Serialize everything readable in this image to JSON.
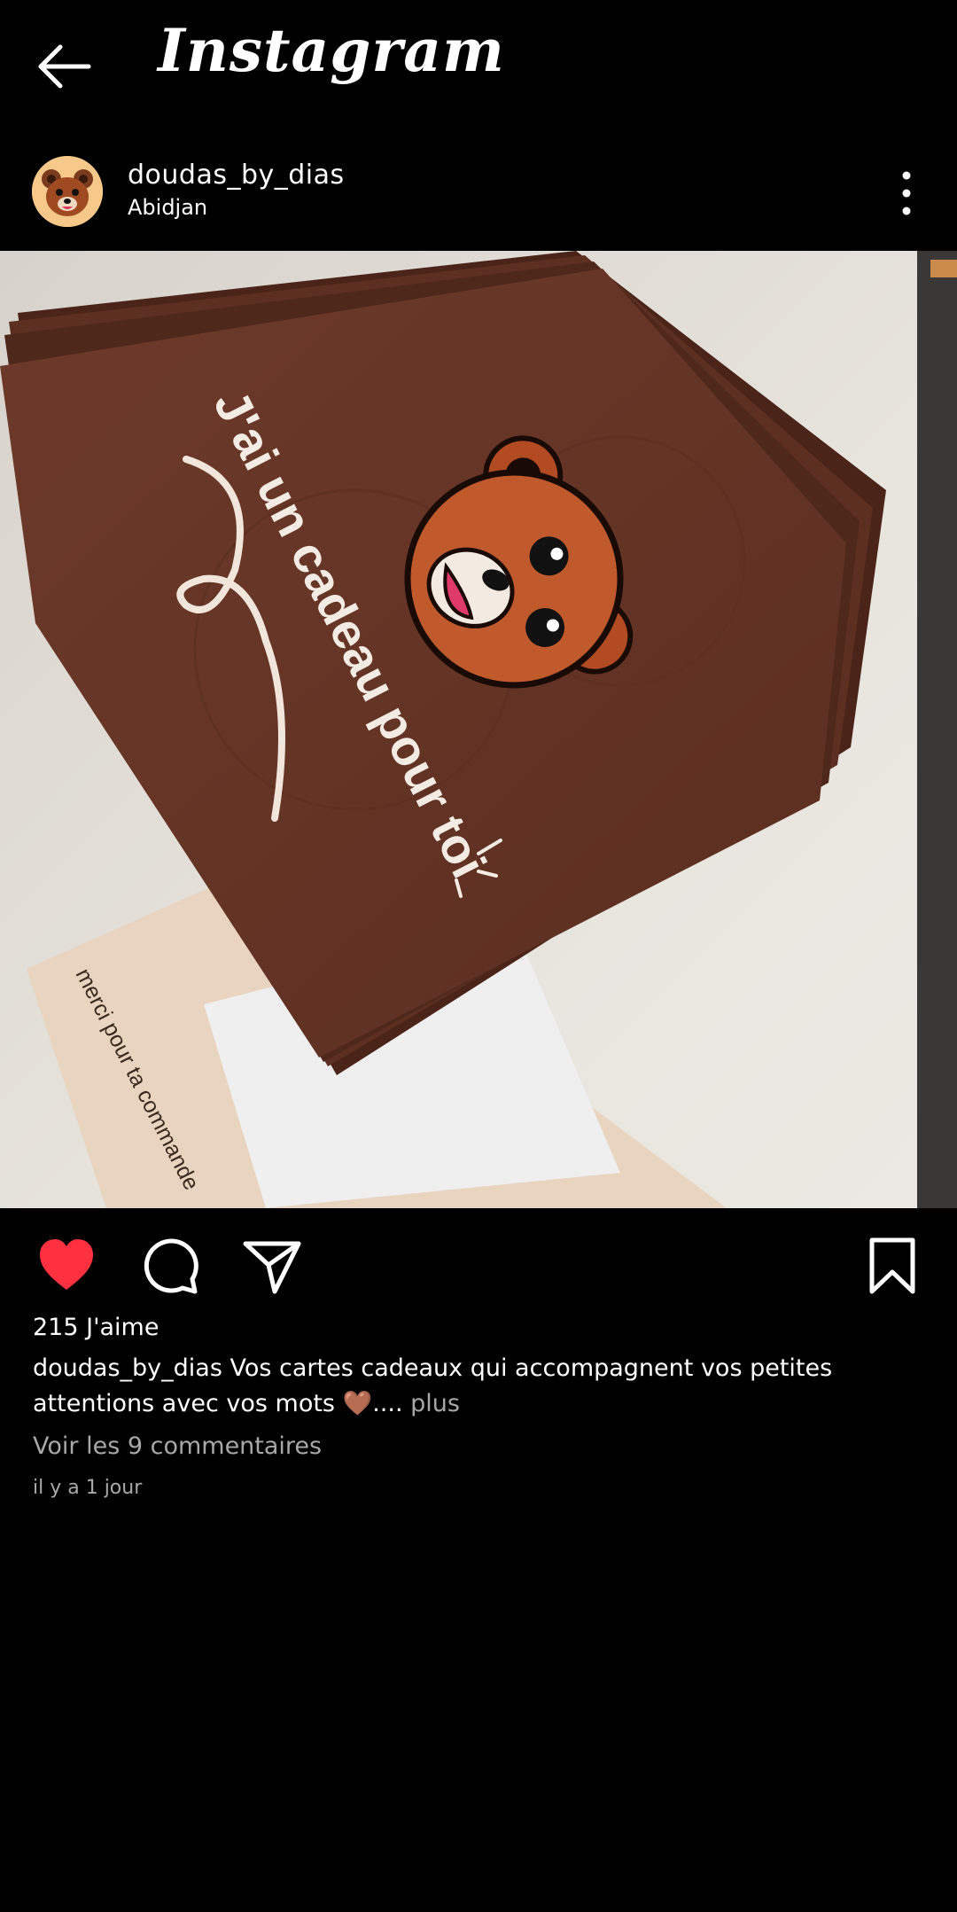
{
  "topbar": {
    "title": "Instagram",
    "back_icon": "arrow-left-icon"
  },
  "post": {
    "username": "doudas_by_dias",
    "location": "Abidjan",
    "avatar_icon": "teddy-bear-avatar",
    "more_icon": "more-vertical-icon",
    "image": {
      "card_text": "J'ai un cadeau pour toi",
      "envelope_text": "merci pour ta commande"
    },
    "actions": {
      "like_icon": "heart-filled-icon",
      "comment_icon": "comment-icon",
      "share_icon": "send-icon",
      "save_icon": "bookmark-icon",
      "like_color": "#ff3040"
    },
    "likes": "215 J'aime",
    "caption": {
      "user": "doudas_by_dias",
      "text": "Vos cartes cadeaux qui accompagnent vos petites attentions avec vos mots 🤎.... ",
      "more": "plus"
    },
    "comments_link": "Voir les 9 commentaires",
    "timestamp": "il y a 1 jour"
  }
}
